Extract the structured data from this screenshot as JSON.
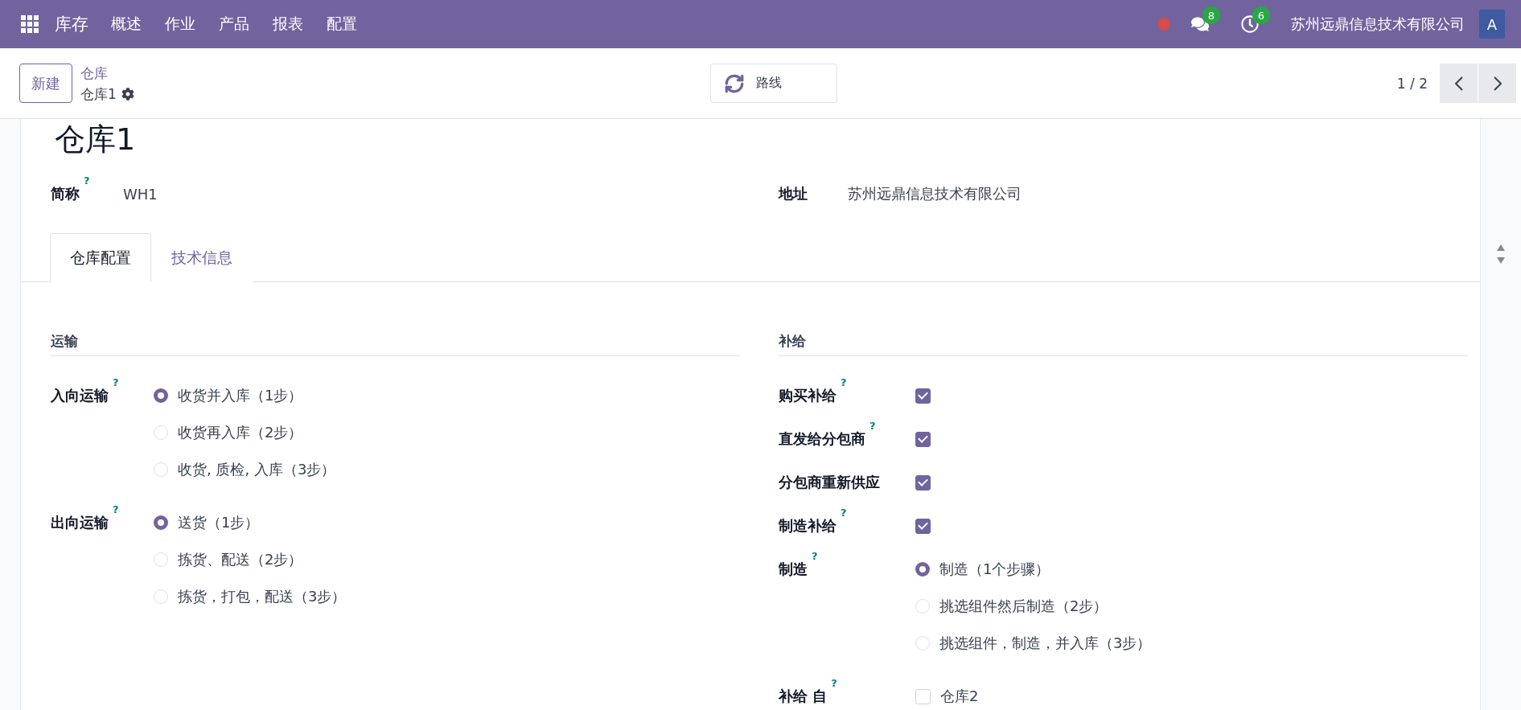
{
  "navbar": {
    "app_name": "库存",
    "menu": [
      "概述",
      "作业",
      "产品",
      "报表",
      "配置"
    ],
    "messages_count": "8",
    "activities_count": "6",
    "company": "苏州远鼎信息技术有限公司",
    "avatar": "A"
  },
  "control_panel": {
    "new_button": "新建",
    "breadcrumb": {
      "parent": "仓库",
      "current": "仓库1"
    },
    "route_button": "路线",
    "pager": "1 / 2"
  },
  "form": {
    "title": "仓库1",
    "fields": [
      {
        "label": "简称",
        "help": "?",
        "value": "WH1"
      },
      {
        "label": "地址",
        "value": "苏州远鼎信息技术有限公司"
      }
    ],
    "tabs": [
      {
        "label": "仓库配置",
        "selected": true
      },
      {
        "label": "技术信息",
        "selected": false
      }
    ],
    "sections": [
      {
        "heading": "运输",
        "rows": [
          {
            "kind": "radio",
            "label": "入向运输",
            "help": "?",
            "options": [
              {
                "label": "收货并入库（1步）",
                "selected": true
              },
              {
                "label": "收货再入库（2步）",
                "selected": false
              },
              {
                "label": "收货, 质检, 入库（3步）",
                "selected": false
              }
            ]
          },
          {
            "kind": "radio",
            "label": "出向运输",
            "help": "?",
            "options": [
              {
                "label": "送货（1步）",
                "selected": true
              },
              {
                "label": "拣货、配送（2步）",
                "selected": false
              },
              {
                "label": "拣货，打包，配送（3步）",
                "selected": false
              }
            ]
          }
        ]
      },
      {
        "heading": "补给",
        "rows": [
          {
            "kind": "checkbox",
            "label": "购买补给",
            "help": "?",
            "checked": true
          },
          {
            "kind": "checkbox",
            "label": "直发给分包商",
            "help": "?",
            "checked": true
          },
          {
            "kind": "checkbox",
            "label": "分包商重新供应",
            "checked": true
          },
          {
            "kind": "checkbox",
            "label": "制造补给",
            "help": "?",
            "checked": true
          },
          {
            "kind": "radio",
            "label": "制造",
            "help": "?",
            "options": [
              {
                "label": "制造（1个步骤）",
                "selected": true
              },
              {
                "label": "挑选组件然后制造（2步）",
                "selected": false
              },
              {
                "label": "挑选组件，制造，并入库（3步）",
                "selected": false
              }
            ]
          },
          {
            "kind": "checklist",
            "label": "补给 自",
            "help": "?",
            "options": [
              {
                "label": "仓库2",
                "checked": false
              }
            ]
          }
        ]
      }
    ]
  }
}
